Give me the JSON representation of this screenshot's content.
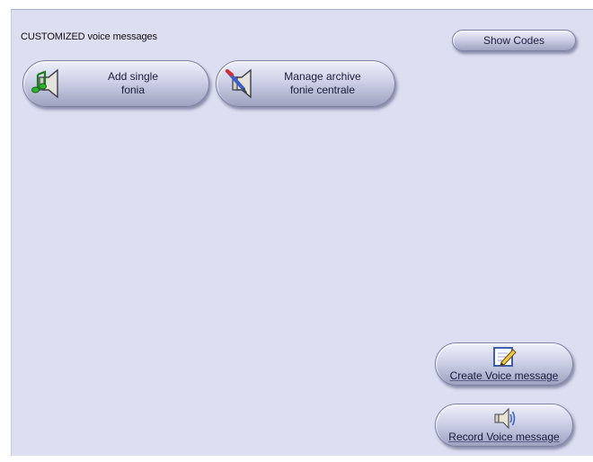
{
  "window": {
    "title": "CUSTOMIZED voice messages"
  },
  "toolbar": {
    "show_codes_label": "Show Codes"
  },
  "main": {
    "buttons": [
      {
        "label_line1": "Add single",
        "label_line2": "fonia",
        "icon": "speaker-music-note-icon"
      },
      {
        "label_line1": "Manage archive",
        "label_line2": "fonie centrale",
        "icon": "speaker-pencil-icon"
      }
    ]
  },
  "actions": {
    "create_label": "Create Voice message",
    "create_icon": "edit-document-icon",
    "record_label": "Record Voice message",
    "record_icon": "speaker-sound-icon"
  },
  "colors": {
    "background": "#dcdef1",
    "button_face": "#c9cce3",
    "button_border": "#7d81a3"
  }
}
